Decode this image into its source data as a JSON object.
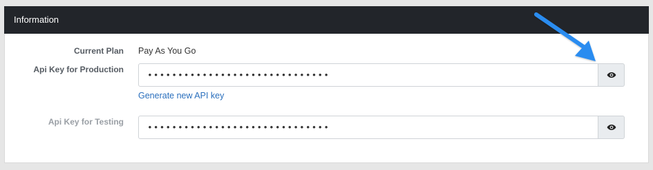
{
  "panel": {
    "title": "Information"
  },
  "plan": {
    "label": "Current Plan",
    "value": "Pay As You Go"
  },
  "production": {
    "label": "Api Key for Production",
    "value": "••••••••••••••••••••••••••••••",
    "reveal_icon": "eye-icon",
    "generate_link": "Generate new API key"
  },
  "testing": {
    "label": "Api Key for Testing",
    "value": "••••••••••••••••••••••••••••••",
    "reveal_icon": "eye-icon"
  },
  "colors": {
    "header_bg": "#22252a",
    "link": "#2a6fbd",
    "arrow": "#2b8cf0"
  }
}
